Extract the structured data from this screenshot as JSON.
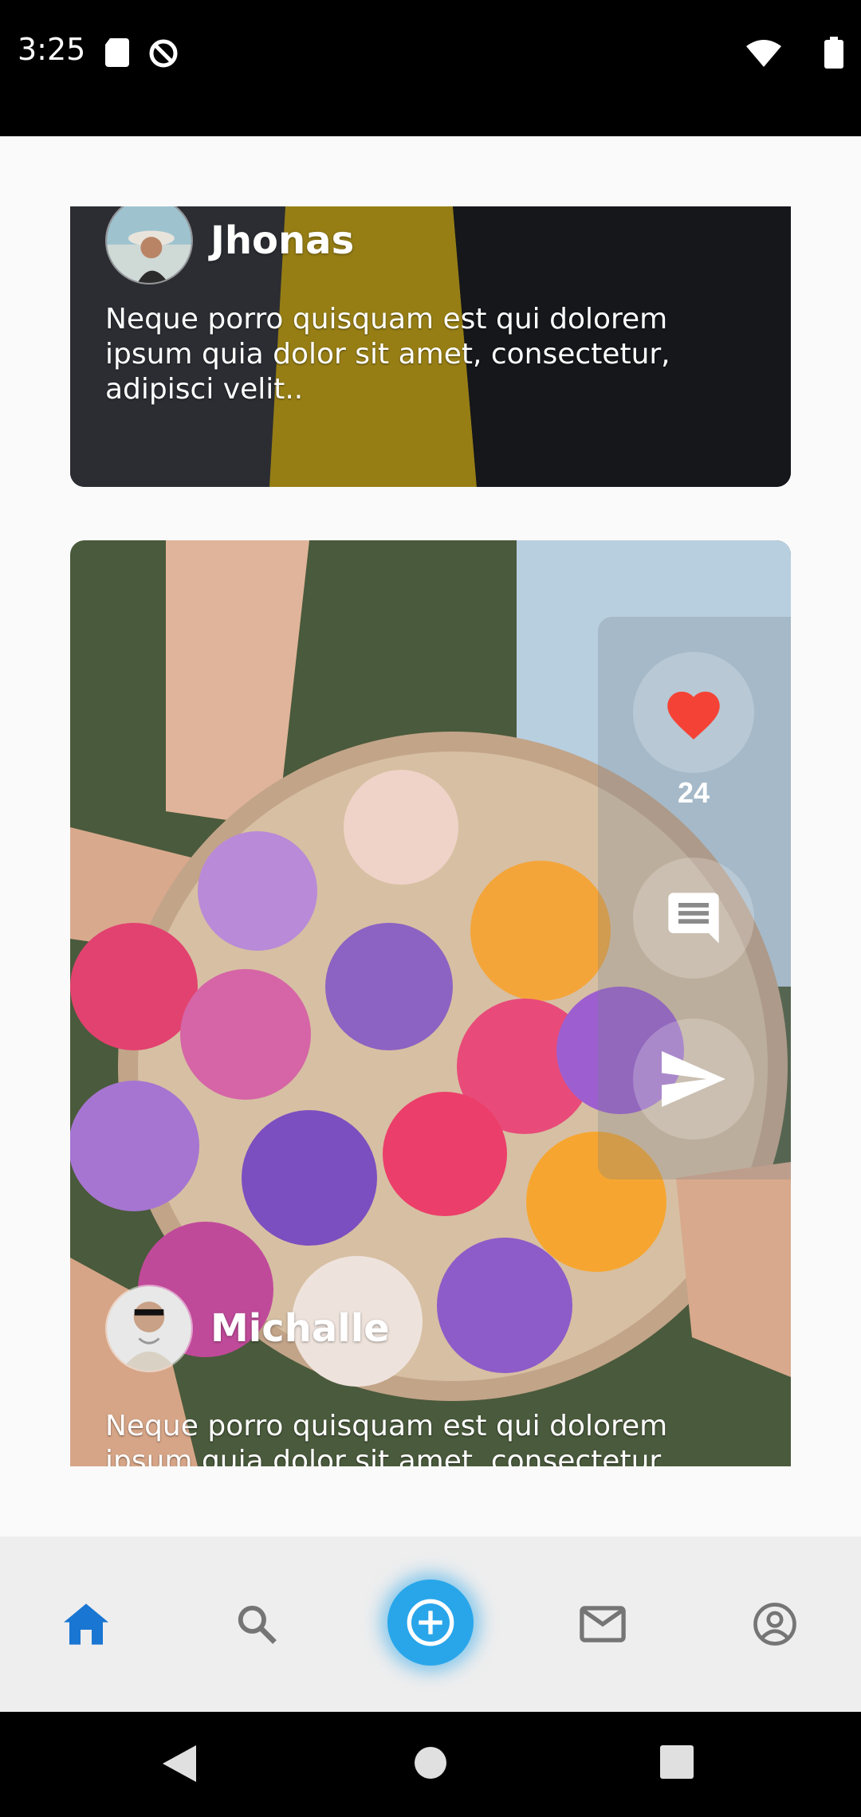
{
  "status_bar": {
    "time": "3:25",
    "icons": [
      "sd-card-icon",
      "no-sync-icon",
      "wifi-icon",
      "battery-icon"
    ]
  },
  "feed": {
    "posts": [
      {
        "author": "Jhonas",
        "caption": "Neque porro quisquam est qui dolorem ipsum quia dolor sit amet, consectetur, adipisci velit.."
      },
      {
        "author": "Michalle",
        "caption": "Neque porro quisquam est qui dolorem ipsum quia dolor sit amet, consectetur, adipisci velit..",
        "likes": "24",
        "actions": [
          "heart-icon",
          "comment-icon",
          "send-icon"
        ]
      }
    ]
  },
  "bottom_nav": {
    "items": [
      "home-icon",
      "search-icon",
      "add-icon",
      "mail-icon",
      "account-icon"
    ],
    "active": "home-icon",
    "colors": {
      "active": "#1976d2",
      "inactive": "#757575",
      "fab": "#29a6ea"
    }
  },
  "system_nav": [
    "back-icon",
    "home-circle-icon",
    "recents-icon"
  ]
}
